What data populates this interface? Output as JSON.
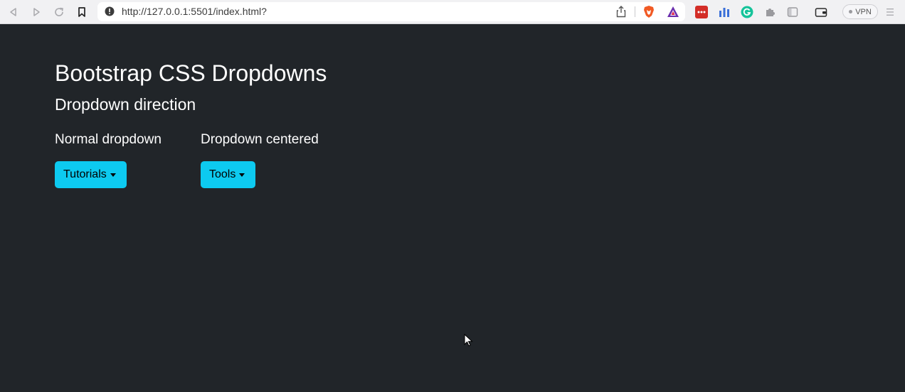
{
  "browser": {
    "url": "http://127.0.0.1:5501/index.html?",
    "vpn_label": "VPN"
  },
  "page": {
    "title": "Bootstrap CSS Dropdowns",
    "subtitle": "Dropdown direction",
    "normal": {
      "heading": "Normal dropdown",
      "button_label": "Tutorials"
    },
    "centered": {
      "heading": "Dropdown centered",
      "button_label": "Tools"
    }
  },
  "colors": {
    "page_background": "#212529",
    "button_info": "#0dcaf0",
    "toolbar_background": "#f1f1f3"
  }
}
